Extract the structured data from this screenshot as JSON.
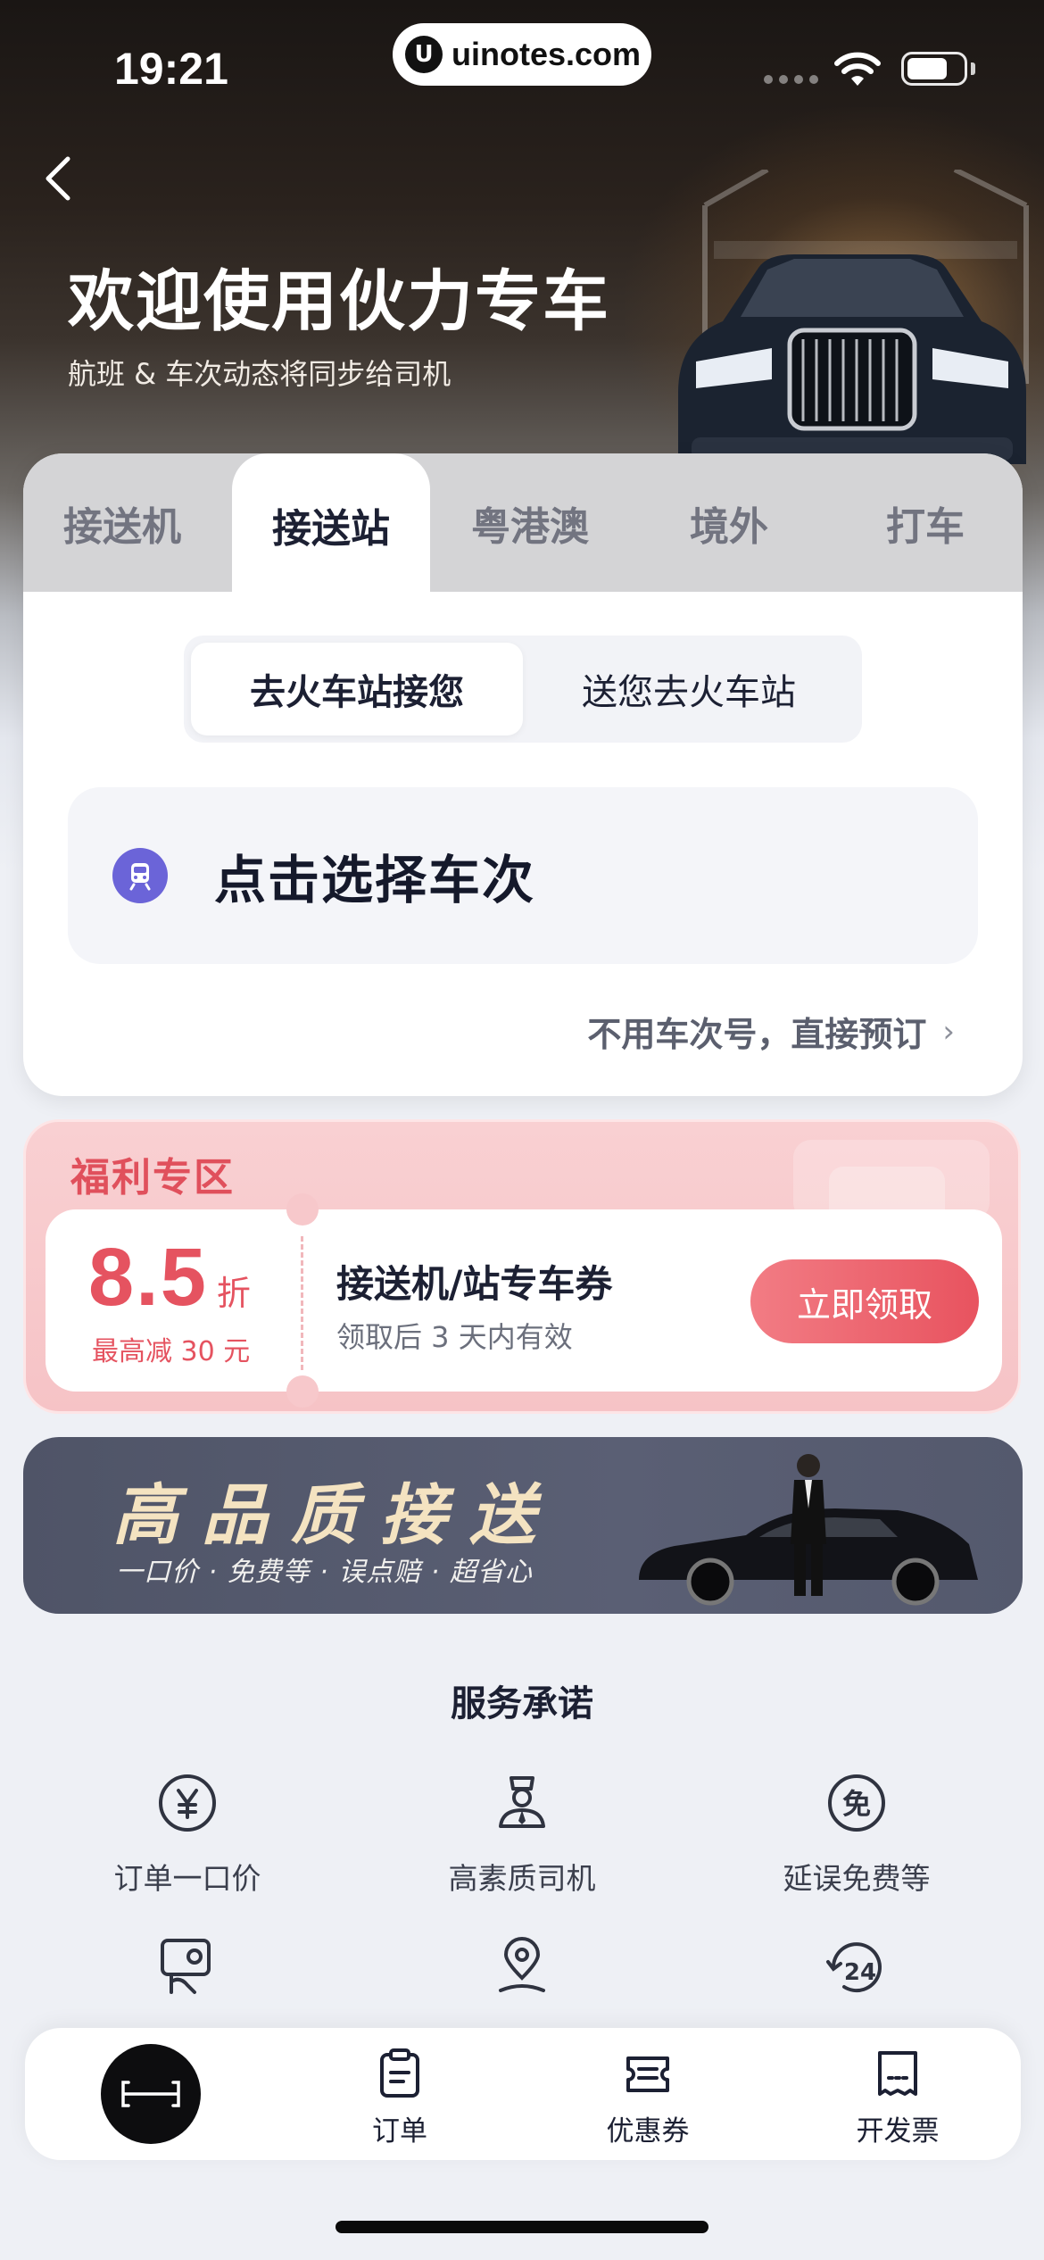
{
  "status_bar": {
    "time": "19:21",
    "url": "uinotes.com"
  },
  "header": {
    "back_icon": "chevron-left-icon",
    "title": "欢迎使用伙力专车",
    "subtitle": "航班 & 车次动态将同步给司机"
  },
  "tabs": [
    {
      "label": "接送机",
      "active": false
    },
    {
      "label": "接送站",
      "active": true
    },
    {
      "label": "粤港澳",
      "active": false
    },
    {
      "label": "境外",
      "active": false
    },
    {
      "label": "打车",
      "active": false
    }
  ],
  "segment": {
    "options": [
      "去火车站接您",
      "送您去火车站"
    ],
    "selected": "去火车站接您"
  },
  "train_select": {
    "icon": "train-icon",
    "label": "点击选择车次"
  },
  "direct_book": {
    "label": "不用车次号，直接预订",
    "icon": "chevron-right-icon"
  },
  "welfare": {
    "title": "福利专区",
    "coupon": {
      "discount": "8.5",
      "discount_unit": "折",
      "cap": "最高减 30 元",
      "name": "接送机/站专车券",
      "validity": "领取后 3 天内有效",
      "button": "立即领取"
    },
    "accent_color": "#e55360"
  },
  "banner": {
    "title": "高品质接送",
    "subtitle": "一口价 · 免费等 · 误点赔 · 超省心"
  },
  "promise": {
    "title": "服务承诺",
    "items": [
      {
        "label": "订单一口价",
        "icon": "yen-circle-icon"
      },
      {
        "label": "高素质司机",
        "icon": "driver-icon"
      },
      {
        "label": "延误免费等",
        "icon": "free-circle-icon"
      },
      {
        "label": "",
        "icon": "compensation-icon"
      },
      {
        "label": "",
        "icon": "location-guide-icon"
      },
      {
        "label": "",
        "icon": "24-hour-icon"
      }
    ]
  },
  "bottom_nav": {
    "items": [
      {
        "label": "",
        "icon": "home-logo-icon"
      },
      {
        "label": "订单",
        "icon": "clipboard-icon"
      },
      {
        "label": "优惠券",
        "icon": "ticket-icon"
      },
      {
        "label": "开发票",
        "icon": "invoice-icon"
      }
    ]
  },
  "colors": {
    "accent_purple": "#6b64d8",
    "text_primary": "#1c2033",
    "coupon_red": "#e55360",
    "banner_gold": "#f4e3c1"
  }
}
